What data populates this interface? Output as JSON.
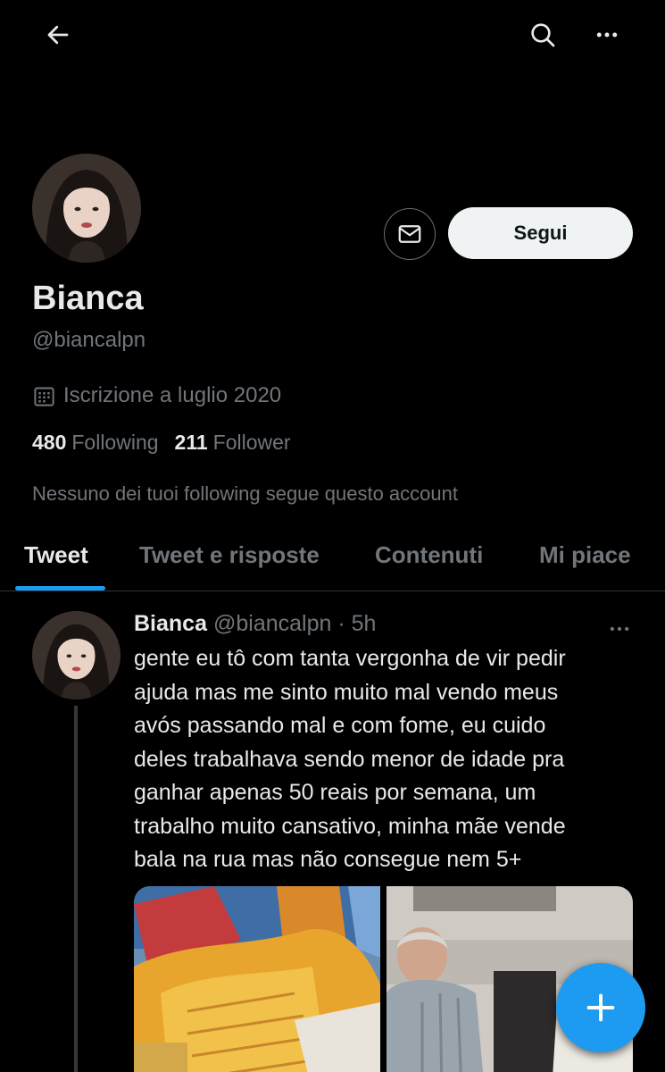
{
  "topbar": {
    "back_icon": "arrow-left-icon",
    "search_icon": "search-icon",
    "more_icon": "more-horizontal-icon"
  },
  "profile": {
    "display_name": "Bianca",
    "handle": "@biancalpn",
    "joined": "Iscrizione a luglio 2020",
    "following_count": "480",
    "following_label": "Following",
    "followers_count": "211",
    "followers_label": "Follower",
    "mutuals_note": "Nessuno dei tuoi following segue questo account",
    "follow_button": "Segui",
    "message_icon": "envelope-icon"
  },
  "tabs": [
    {
      "label": "Tweet",
      "active": true
    },
    {
      "label": "Tweet e risposte",
      "active": false
    },
    {
      "label": "Contenuti",
      "active": false
    },
    {
      "label": "Mi piace",
      "active": false
    }
  ],
  "tweet": {
    "name": "Bianca",
    "meta": "@biancalpn · 5h",
    "text": "gente eu tô com tanta vergonha de vir pedir\najuda mas me sinto muito mal vendo meus\navós passando mal e com fome, eu cuido\ndeles trabalhava sendo menor de idade pra\nganhar apenas 50 reais por semana, um\ntrabalho muito cansativo, minha mãe vende\nbala na rua mas não consegue nem 5+"
  },
  "fab": {
    "icon": "plus-icon"
  },
  "colors": {
    "background": "#000000",
    "accent": "#1d9bf0",
    "text_primary": "#e7e9ea",
    "text_secondary": "#71767b"
  }
}
